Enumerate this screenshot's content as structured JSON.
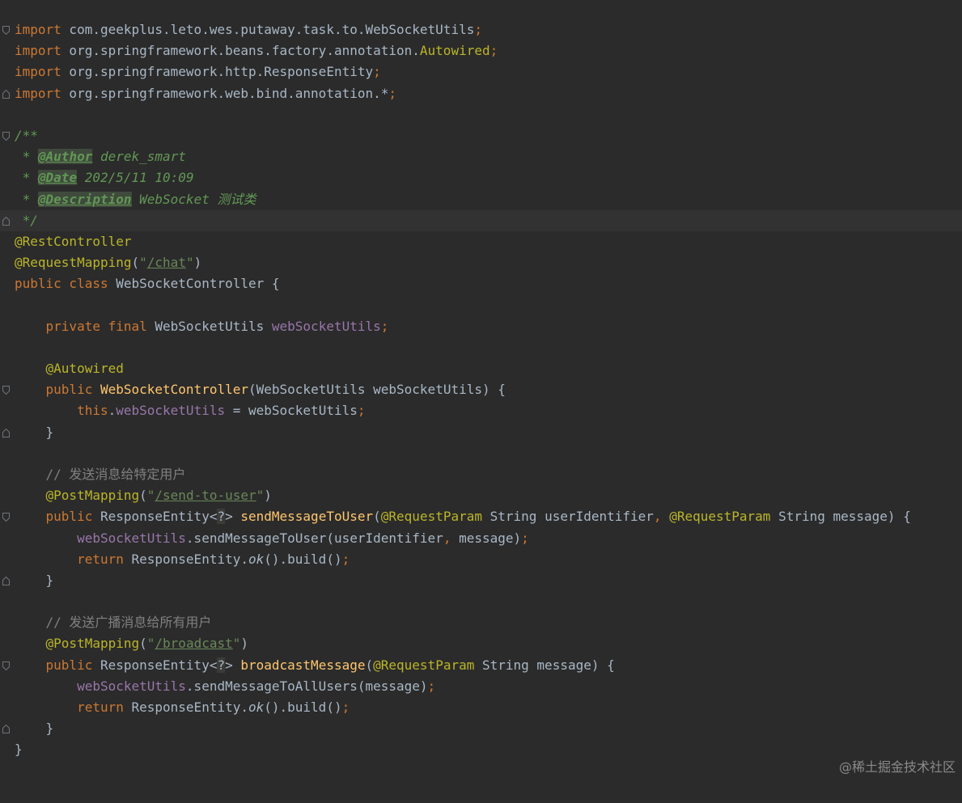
{
  "editor": {
    "language": "java",
    "colors": {
      "background": "#2b2b2b",
      "current_line": "#323232",
      "keyword": "#cc7832",
      "annotation": "#bbb529",
      "string": "#6a8759",
      "field": "#9876aa",
      "method": "#ffc66d",
      "doc_comment": "#629755",
      "line_comment": "#808080",
      "default_text": "#a9b7c6"
    },
    "code": {
      "import1": {
        "kw": "import",
        "path": " com.geekplus.leto.wes.putaway.task.to.WebSocketUtils",
        "semi": ";"
      },
      "import2": {
        "kw": "import",
        "path": " org.springframework.beans.factory.annotation.",
        "ann": "Autowired",
        "semi": ";"
      },
      "import3": {
        "kw": "import",
        "path": " org.springframework.http.ResponseEntity",
        "semi": ";"
      },
      "import4": {
        "kw": "import",
        "path": " org.springframework.web.bind.annotation.*",
        "semi": ";"
      },
      "doc_open": "/**",
      "doc_author": {
        "prefix": " * ",
        "tag": "@Author",
        "value": " derek_smart"
      },
      "doc_date": {
        "prefix": " * ",
        "tag": "@Date",
        "value": " 202/5/11 10:09"
      },
      "doc_desc": {
        "prefix": " * ",
        "tag": "@Description",
        "value": " WebSocket 测试类"
      },
      "doc_close": " */",
      "ann_rest": "@RestController",
      "ann_reqmap": {
        "name": "@RequestMapping",
        "open": "(",
        "q1": "\"",
        "url": "/chat",
        "q2": "\"",
        "close": ")"
      },
      "class_decl": {
        "kw": "public class",
        "name": " WebSocketController {"
      },
      "field_decl": {
        "indent": "    ",
        "kw": "private final",
        "type": " WebSocketUtils ",
        "name": "webSocketUtils",
        "semi": ";"
      },
      "autowired": {
        "indent": "    ",
        "ann": "@Autowired"
      },
      "ctor_decl": {
        "indent": "    ",
        "kw": "public",
        "sp": " ",
        "name": "WebSocketController",
        "params": "(WebSocketUtils webSocketUtils) {"
      },
      "ctor_body": {
        "indent": "        ",
        "kw": "this",
        "dot": ".",
        "field": "webSocketUtils",
        "rest": " = webSocketUtils",
        "semi": ";"
      },
      "ctor_close": "    }",
      "comment1": "    // 发送消息给特定用户",
      "post1": {
        "indent": "    ",
        "name": "@PostMapping",
        "open": "(",
        "q1": "\"",
        "url": "/send-to-user",
        "q2": "\"",
        "close": ")"
      },
      "method1_decl": {
        "indent": "    ",
        "kw": "public",
        "type": " ResponseEntity<",
        "wild": "?",
        "type2": "> ",
        "name": "sendMessageToUser",
        "p1_open": "(",
        "p1_ann": "@RequestParam",
        "p1_rest": " String userIdentifier",
        "comma": ",",
        "sp": " ",
        "p2_ann": "@RequestParam",
        "p2_rest": " String message) {"
      },
      "method1_body1": {
        "indent": "        ",
        "field": "webSocketUtils",
        "call": ".sendMessageToUser(userIdentifier",
        "comma": ",",
        "rest": " message)",
        "semi": ";"
      },
      "method1_body2": {
        "indent": "        ",
        "kw": "return",
        "rest": " ResponseEntity.",
        "static": "ok",
        "rest2": "().build()",
        "semi": ";"
      },
      "method1_close": "    }",
      "comment2": "    // 发送广播消息给所有用户",
      "post2": {
        "indent": "    ",
        "name": "@PostMapping",
        "open": "(",
        "q1": "\"",
        "url": "/broadcast",
        "q2": "\"",
        "close": ")"
      },
      "method2_decl": {
        "indent": "    ",
        "kw": "public",
        "type": " ResponseEntity<",
        "wild": "?",
        "type2": "> ",
        "name": "broadcastMessage",
        "p1_open": "(",
        "p1_ann": "@RequestParam",
        "p1_rest": " String message) {"
      },
      "method2_body1": {
        "indent": "        ",
        "field": "webSocketUtils",
        "call": ".sendMessageToAllUsers(message)",
        "semi": ";"
      },
      "method2_body2": {
        "indent": "        ",
        "kw": "return",
        "rest": " ResponseEntity.",
        "static": "ok",
        "rest2": "().build()",
        "semi": ";"
      },
      "method2_close": "    }",
      "class_close": "}"
    }
  },
  "watermark": "@稀土掘金技术社区"
}
